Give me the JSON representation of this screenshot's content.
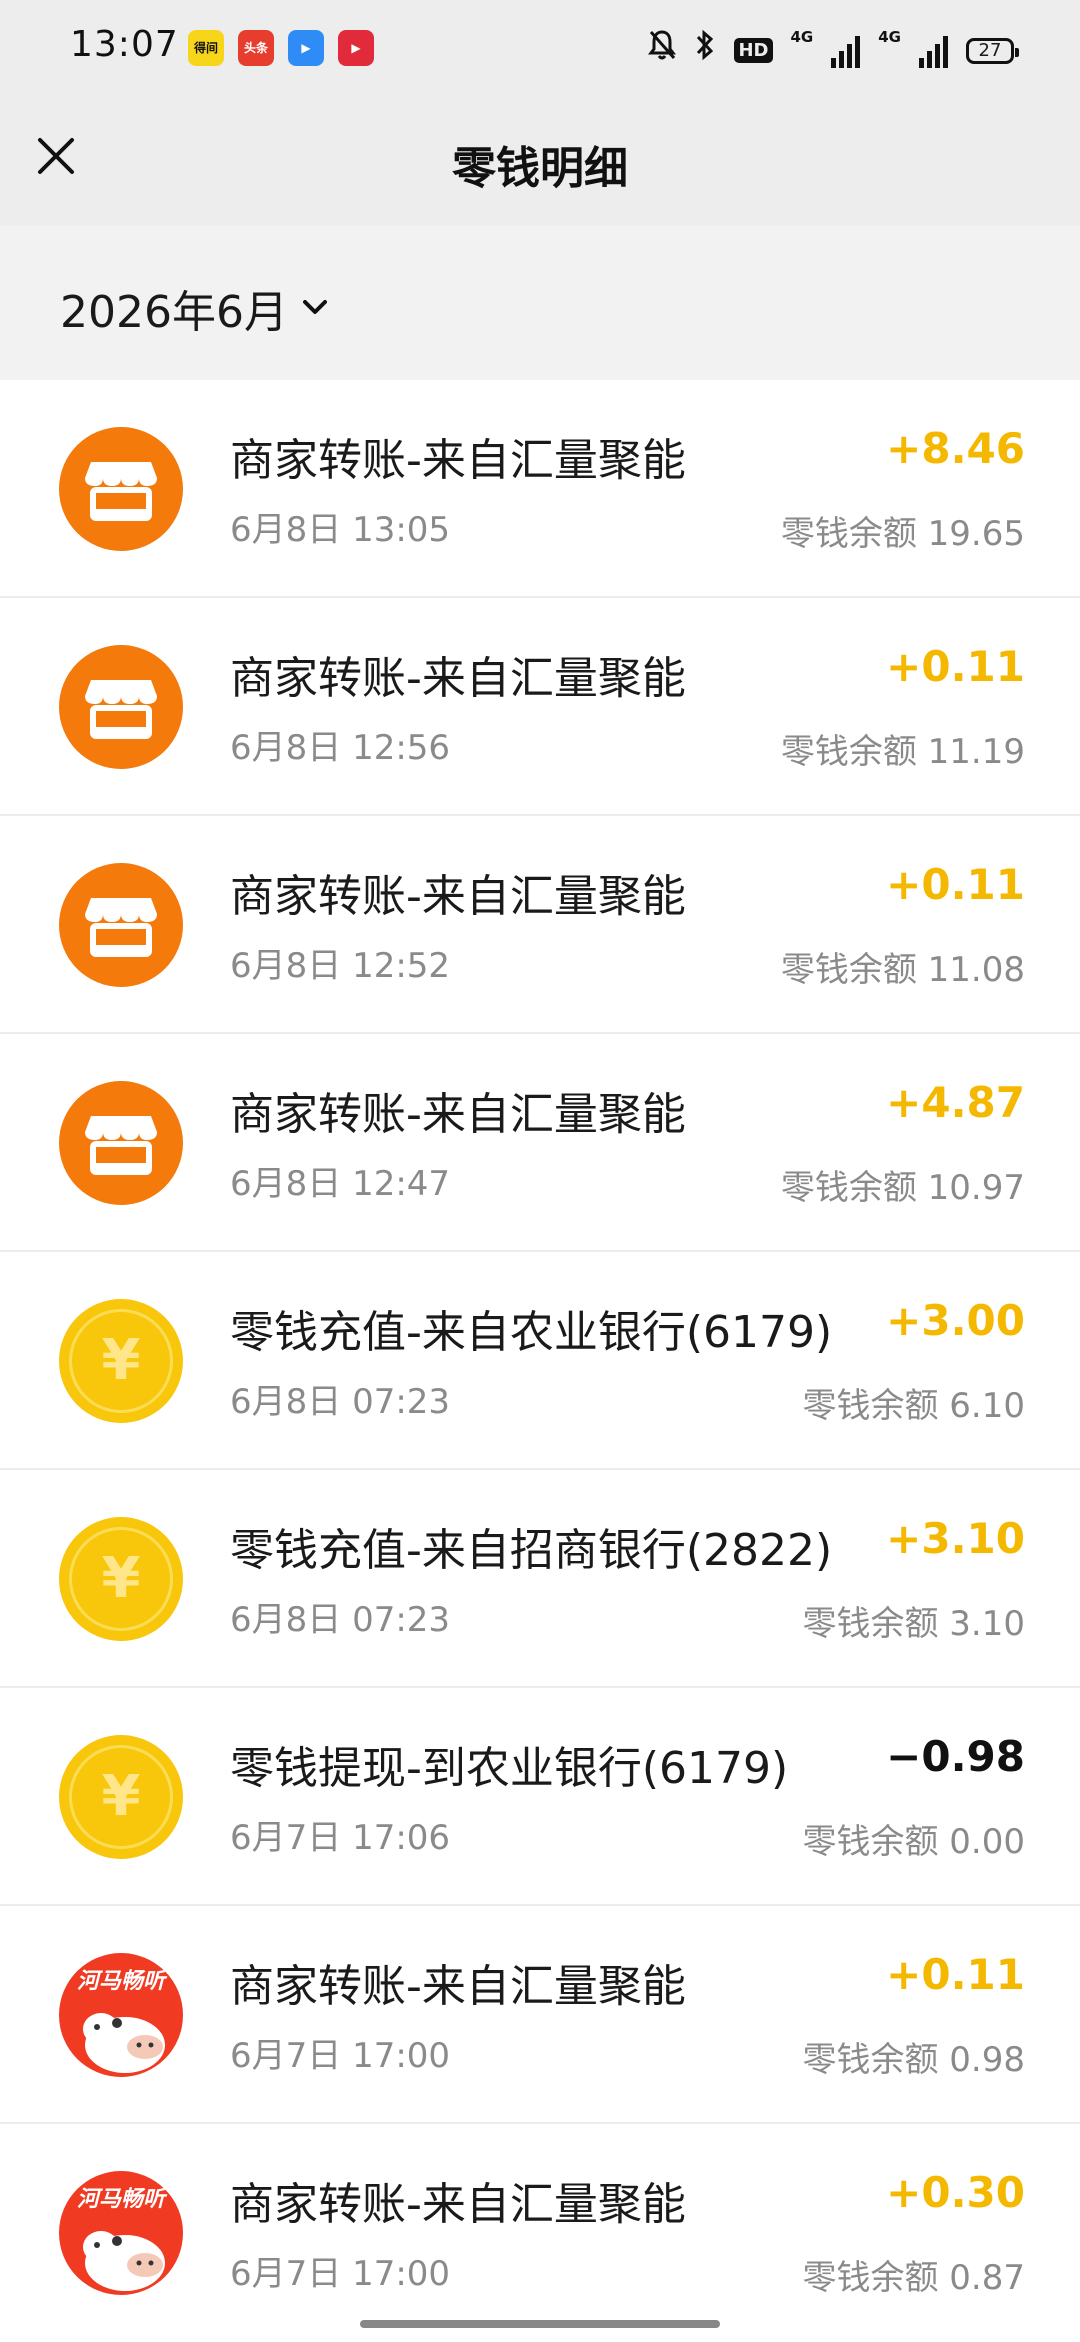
{
  "status_bar": {
    "time": "13:07",
    "apps": [
      {
        "icon": "dewu-app-icon",
        "label": "得间",
        "color": "#f7d51a",
        "text_color": "#111111"
      },
      {
        "icon": "toutiao-app-icon",
        "label": "头条",
        "color": "#e73d2f",
        "text_color": "#ffffff"
      },
      {
        "icon": "player-app-icon",
        "label": "▶",
        "color": "#2f8cf7",
        "text_color": "#ffffff"
      },
      {
        "icon": "video-app-icon",
        "label": "▶",
        "color": "#e22b3a",
        "text_color": "#ffffff"
      }
    ],
    "hd_label": "HD",
    "net1": "4G",
    "net2": "4G",
    "battery": "27"
  },
  "header": {
    "title": "零钱明细"
  },
  "month_selector": {
    "label": "2026年6月"
  },
  "transactions": [
    {
      "icon": "shop-icon",
      "kind": "orange",
      "title": "商家转账-来自汇量聚能",
      "date": "6月8日 13:05",
      "amount": "+8.46",
      "negative": false,
      "balance": "零钱余额 19.65"
    },
    {
      "icon": "shop-icon",
      "kind": "orange",
      "title": "商家转账-来自汇量聚能",
      "date": "6月8日 12:56",
      "amount": "+0.11",
      "negative": false,
      "balance": "零钱余额 11.19"
    },
    {
      "icon": "shop-icon",
      "kind": "orange",
      "title": "商家转账-来自汇量聚能",
      "date": "6月8日 12:52",
      "amount": "+0.11",
      "negative": false,
      "balance": "零钱余额 11.08"
    },
    {
      "icon": "shop-icon",
      "kind": "orange",
      "title": "商家转账-来自汇量聚能",
      "date": "6月8日 12:47",
      "amount": "+4.87",
      "negative": false,
      "balance": "零钱余额 10.97"
    },
    {
      "icon": "yen-coin-icon",
      "kind": "yellow",
      "title": "零钱充值-来自农业银行(6179)",
      "date": "6月8日 07:23",
      "amount": "+3.00",
      "negative": false,
      "balance": "零钱余额 6.10"
    },
    {
      "icon": "yen-coin-icon",
      "kind": "yellow",
      "title": "零钱充值-来自招商银行(2822)",
      "date": "6月8日 07:23",
      "amount": "+3.10",
      "negative": false,
      "balance": "零钱余额 3.10"
    },
    {
      "icon": "yen-coin-icon",
      "kind": "yellow",
      "title": "零钱提现-到农业银行(6179)",
      "date": "6月7日 17:06",
      "amount": "−0.98",
      "negative": true,
      "balance": "零钱余额 0.00"
    },
    {
      "icon": "hippo-app-icon",
      "kind": "hippo",
      "logo_text": "河马畅听",
      "title": "商家转账-来自汇量聚能",
      "date": "6月7日 17:00",
      "amount": "+0.11",
      "negative": false,
      "balance": "零钱余额 0.98"
    },
    {
      "icon": "hippo-app-icon",
      "kind": "hippo",
      "logo_text": "河马畅听",
      "title": "商家转账-来自汇量聚能",
      "date": "6月7日 17:00",
      "amount": "+0.30",
      "negative": false,
      "balance": "零钱余额 0.87"
    }
  ]
}
